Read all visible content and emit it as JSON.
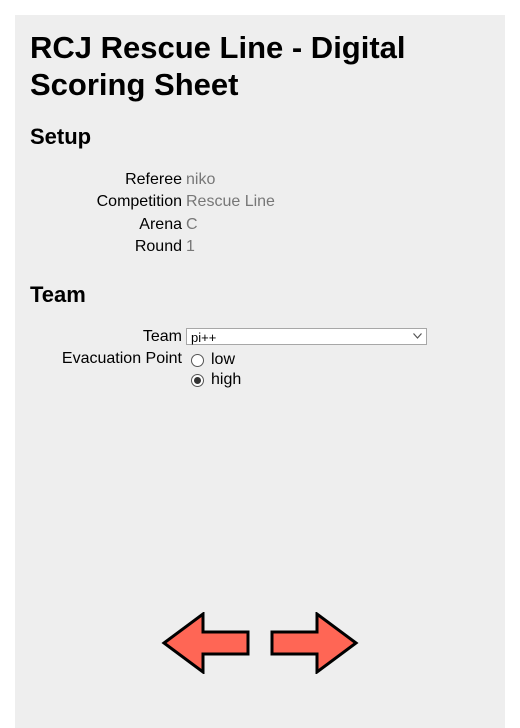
{
  "page": {
    "title": "RCJ Rescue Line - Digital Scoring Sheet"
  },
  "setup": {
    "heading": "Setup",
    "fields": [
      {
        "label": "Referee",
        "value": "niko"
      },
      {
        "label": "Competition",
        "value": "Rescue Line"
      },
      {
        "label": "Arena",
        "value": "C"
      },
      {
        "label": "Round",
        "value": "1"
      }
    ]
  },
  "team": {
    "heading": "Team",
    "team_label": "Team",
    "team_selected": "pi++",
    "evacuation_label": "Evacuation Point",
    "evacuation_options": [
      {
        "label": "low",
        "checked": false
      },
      {
        "label": "high",
        "checked": true
      }
    ]
  },
  "navigation": {
    "back_icon": "arrow-left-icon",
    "next_icon": "arrow-right-icon",
    "arrow_color": "#ff6655"
  }
}
